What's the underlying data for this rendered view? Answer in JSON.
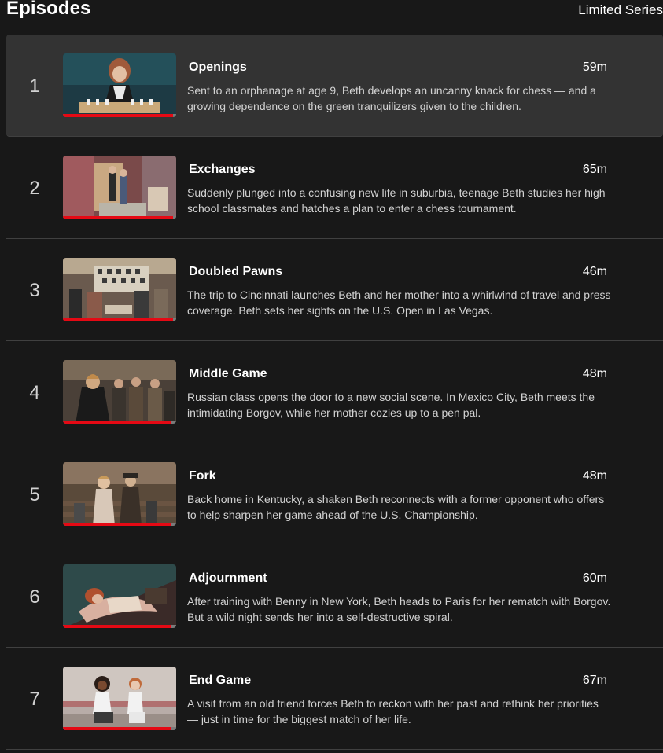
{
  "header": {
    "title": "Episodes",
    "tag": "Limited Series"
  },
  "episodes": [
    {
      "number": "1",
      "title": "Openings",
      "duration": "59m",
      "description": "Sent to an orphanage at age 9, Beth develops an uncanny knack for chess — and a growing dependence on the green tranquilizers given to the children.",
      "progress": 0.97,
      "active": true
    },
    {
      "number": "2",
      "title": "Exchanges",
      "duration": "65m",
      "description": "Suddenly plunged into a confusing new life in suburbia, teenage Beth studies her high school classmates and hatches a plan to enter a chess tournament.",
      "progress": 0.97,
      "active": false
    },
    {
      "number": "3",
      "title": "Doubled Pawns",
      "duration": "46m",
      "description": "The trip to Cincinnati launches Beth and her mother into a whirlwind of travel and press coverage. Beth sets her sights on the U.S. Open in Las Vegas.",
      "progress": 0.97,
      "active": false
    },
    {
      "number": "4",
      "title": "Middle Game",
      "duration": "48m",
      "description": "Russian class opens the door to a new social scene. In Mexico City, Beth meets the intimidating Borgov, while her mother cozies up to a pen pal.",
      "progress": 0.96,
      "active": false
    },
    {
      "number": "5",
      "title": "Fork",
      "duration": "48m",
      "description": "Back home in Kentucky, a shaken Beth reconnects with a former opponent who offers to help sharpen her game ahead of the U.S. Championship.",
      "progress": 0.95,
      "active": false
    },
    {
      "number": "6",
      "title": "Adjournment",
      "duration": "60m",
      "description": "After training with Benny in New York, Beth heads to Paris for her rematch with Borgov. But a wild night sends her into a self-destructive spiral.",
      "progress": 0.96,
      "active": false
    },
    {
      "number": "7",
      "title": "End Game",
      "duration": "67m",
      "description": "A visit from an old friend forces Beth to reckon with her past and rethink her priorities — just in time for the biggest match of her life.",
      "progress": 0.96,
      "active": false
    }
  ],
  "colors": {
    "background": "#181818",
    "active_row": "#333333",
    "progress_fill": "#e50914",
    "progress_track": "#7a7a7a",
    "divider": "#404040"
  }
}
